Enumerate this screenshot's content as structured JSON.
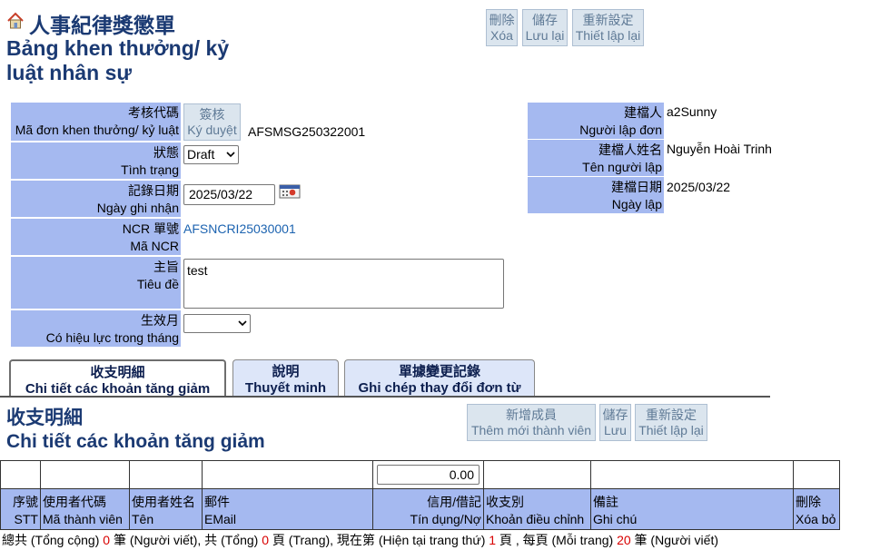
{
  "header": {
    "title_cn": "人事紀律獎懲單",
    "title_vi": "Bảng khen thưởng/ kỷ luật nhân sự"
  },
  "toolbar": {
    "delete": {
      "cn": "刪除",
      "vi": "Xóa"
    },
    "save": {
      "cn": "儲存",
      "vi": "Lưu lại"
    },
    "reset": {
      "cn": "重新設定",
      "vi": "Thiết lập lại"
    }
  },
  "form": {
    "code": {
      "cn": "考核代碼",
      "vi": "Mã đơn khen thưởng/ kỷ luật",
      "value": "AFSMSG250322001"
    },
    "approve": {
      "cn": "簽核",
      "vi": "Ký duyệt"
    },
    "status": {
      "cn": "狀態",
      "vi": "Tình trạng",
      "value": "Draft"
    },
    "record_date": {
      "cn": "記錄日期",
      "vi": "Ngày ghi nhận",
      "value": "2025/03/22"
    },
    "ncr": {
      "cn": "NCR 單號",
      "vi": "Mã NCR",
      "value": "AFSNCRI25030001"
    },
    "subject": {
      "cn": "主旨",
      "vi": "Tiêu đề",
      "value": "test"
    },
    "effective_month": {
      "cn": "生效月",
      "vi": "Có hiệu lực trong tháng",
      "value": ""
    }
  },
  "info": {
    "creator": {
      "cn": "建檔人",
      "vi": "Người lập đơn",
      "value": "a2Sunny"
    },
    "creator_name": {
      "cn": "建檔人姓名",
      "vi": "Tên người lập",
      "value": "Nguyễn Hoài Trinh"
    },
    "created_date": {
      "cn": "建檔日期",
      "vi": "Ngày lập",
      "value": "2025/03/22"
    }
  },
  "tabs": [
    {
      "cn": "收支明細",
      "vi": "Chi tiết các khoản tăng giảm",
      "active": true
    },
    {
      "cn": "說明",
      "vi": "Thuyết minh",
      "active": false
    },
    {
      "cn": "單據變更記錄",
      "vi": "Ghi chép thay đổi đơn từ",
      "active": false
    }
  ],
  "section": {
    "title_cn": "收支明細",
    "title_vi": "Chi tiết các khoản tăng giảm",
    "add_member": {
      "cn": "新增成員",
      "vi": "Thêm mới thành viên"
    },
    "save": {
      "cn": "儲存",
      "vi": "Lưu"
    },
    "reset": {
      "cn": "重新設定",
      "vi": "Thiết lập lại"
    }
  },
  "table": {
    "total_value": "0.00",
    "columns": [
      {
        "cn": "序號",
        "vi": "STT"
      },
      {
        "cn": "使用者代碼",
        "vi": "Mã thành viên"
      },
      {
        "cn": "使用者姓名",
        "vi": "Tên"
      },
      {
        "cn": "郵件",
        "vi": "EMail"
      },
      {
        "cn": "信用/借記",
        "vi": "Tín dụng/Nợ"
      },
      {
        "cn": "收支別",
        "vi": "Khoản điều chỉnh"
      },
      {
        "cn": "備註",
        "vi": "Ghi chú"
      },
      {
        "cn": "刪除",
        "vi": "Xóa bỏ"
      }
    ]
  },
  "footer": {
    "t1": "總共 (Tổng cộng) ",
    "total": "0",
    "t2": " 筆 (Người viết), 共 (Tổng) ",
    "pages": "0",
    "t3": " 頁 (Trang), 現在第 (Hiện tại trang thứ) ",
    "current": "1",
    "t4": " 頁 , 每頁 (Mỗi trang) ",
    "per_page": "20",
    "t5": " 筆 (Người viết)"
  },
  "colors": {
    "label_bg": "#a5b9f0",
    "title": "#1b3a73",
    "link": "#1c63b0",
    "count_red": "#d80000"
  }
}
